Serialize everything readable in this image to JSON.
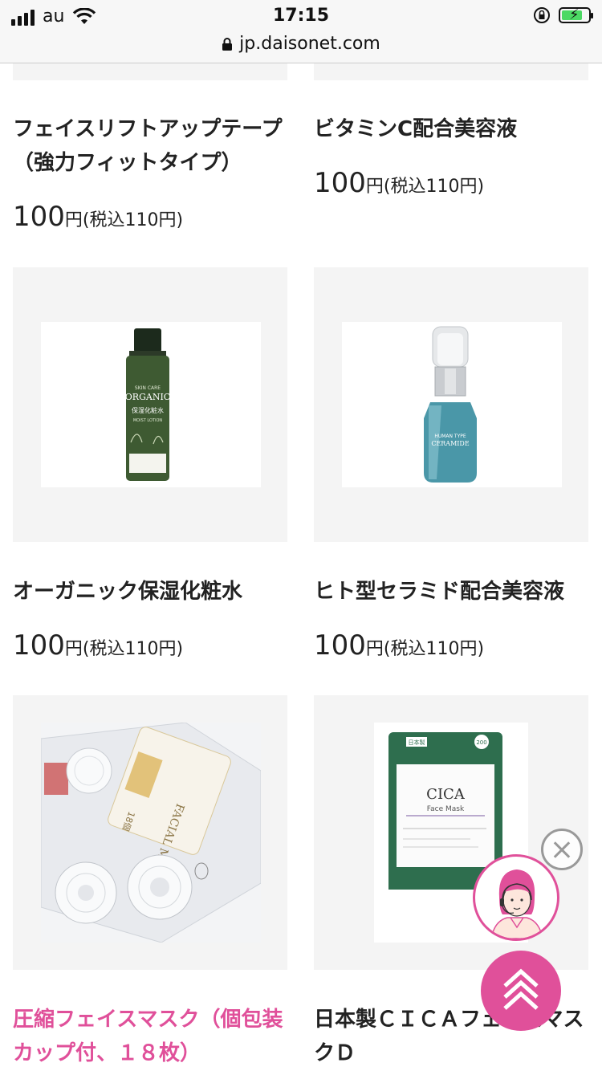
{
  "status_bar": {
    "carrier": "au",
    "time": "17:15"
  },
  "browser": {
    "url": "jp.daisonet.com"
  },
  "products": [
    {
      "name": "フェイスリフトアップテープ（強力フィットタイプ）",
      "price": "100",
      "yen": "円",
      "tax": "(税込110円)"
    },
    {
      "name": "ビタミンC配合美容液",
      "price": "100",
      "yen": "円",
      "tax": "(税込110円)"
    },
    {
      "name": "オーガニック保湿化粧水",
      "price": "100",
      "yen": "円",
      "tax": "(税込110円)"
    },
    {
      "name": "ヒト型セラミド配合美容液",
      "price": "100",
      "yen": "円",
      "tax": "(税込110円)"
    },
    {
      "name": "圧縮フェイスマスク（個包装カップ付、１８枚）"
    },
    {
      "name": "日本製ＣＩＣＡフェイスマスクＤ"
    }
  ],
  "product_images": {
    "lotion": {
      "brand_top": "SKIN CARE",
      "brand": "ORGANIC",
      "line1": "保湿化粧水",
      "line2": "MOIST LOTION"
    },
    "serum": {
      "brand_top": "HUMAN TYPE",
      "brand": "CERAMIDE"
    },
    "facial_mask": {
      "label": "FACIAL MASK",
      "count": "18個"
    },
    "cica": {
      "badge_left": "200",
      "badge_right": "日本製",
      "title": "CICA",
      "subtitle": "Face Mask"
    }
  },
  "colors": {
    "accent_pink": "#e0509a",
    "tile_bg": "#f4f4f4"
  }
}
